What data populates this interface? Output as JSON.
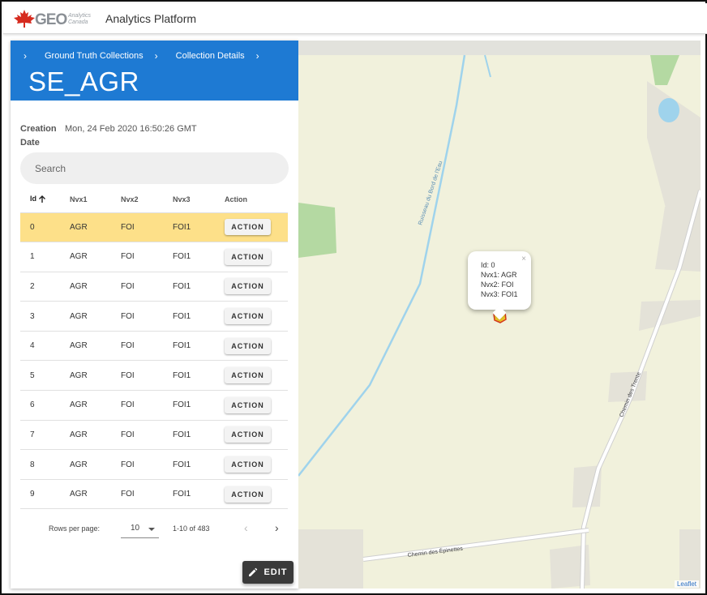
{
  "app": {
    "logo_text": "GEO",
    "logo_subtext_1": "Analytics",
    "logo_subtext_2": "Canada",
    "title": "Analytics Platform"
  },
  "breadcrumbs": [
    "Ground Truth Collections",
    "Collection Details"
  ],
  "panel": {
    "title": "SE_AGR",
    "creation_label_1": "Creation",
    "creation_label_2": "Date",
    "creation_value": "Mon, 24 Feb 2020 16:50:26 GMT"
  },
  "search": {
    "placeholder": "Search"
  },
  "table": {
    "headers": [
      "Id",
      "Nvx1",
      "Nvx2",
      "Nvx3",
      "Action"
    ],
    "action_label": "ACTION",
    "rows": [
      {
        "id": "0",
        "nvx1": "AGR",
        "nvx2": "FOI",
        "nvx3": "FOI1"
      },
      {
        "id": "1",
        "nvx1": "AGR",
        "nvx2": "FOI",
        "nvx3": "FOI1"
      },
      {
        "id": "2",
        "nvx1": "AGR",
        "nvx2": "FOI",
        "nvx3": "FOI1"
      },
      {
        "id": "3",
        "nvx1": "AGR",
        "nvx2": "FOI",
        "nvx3": "FOI1"
      },
      {
        "id": "4",
        "nvx1": "AGR",
        "nvx2": "FOI",
        "nvx3": "FOI1"
      },
      {
        "id": "5",
        "nvx1": "AGR",
        "nvx2": "FOI",
        "nvx3": "FOI1"
      },
      {
        "id": "6",
        "nvx1": "AGR",
        "nvx2": "FOI",
        "nvx3": "FOI1"
      },
      {
        "id": "7",
        "nvx1": "AGR",
        "nvx2": "FOI",
        "nvx3": "FOI1"
      },
      {
        "id": "8",
        "nvx1": "AGR",
        "nvx2": "FOI",
        "nvx3": "FOI1"
      },
      {
        "id": "9",
        "nvx1": "AGR",
        "nvx2": "FOI",
        "nvx3": "FOI1"
      }
    ]
  },
  "pagination": {
    "rows_per_page_label": "Rows per page:",
    "rows_per_page": "10",
    "range": "1-10 of 483"
  },
  "edit_label": "EDIT",
  "map": {
    "labels": {
      "stream": "Ruisseau du Bord de l'Eau",
      "road1": "Chemin des Trente",
      "road2": "Chemin des Épinettes"
    },
    "popup": {
      "line1": "Id: 0",
      "line2": "Nvx1: AGR",
      "line3": "Nvx2: FOI",
      "line4": "Nvx3: FOI1"
    },
    "attribution": "Leaflet"
  },
  "colors": {
    "header_blue": "#1e7ad3",
    "selected_row": "#fde089",
    "map_background": "#f1f1dc",
    "water": "#9fd3ec",
    "forest": "#b4d9a2"
  }
}
